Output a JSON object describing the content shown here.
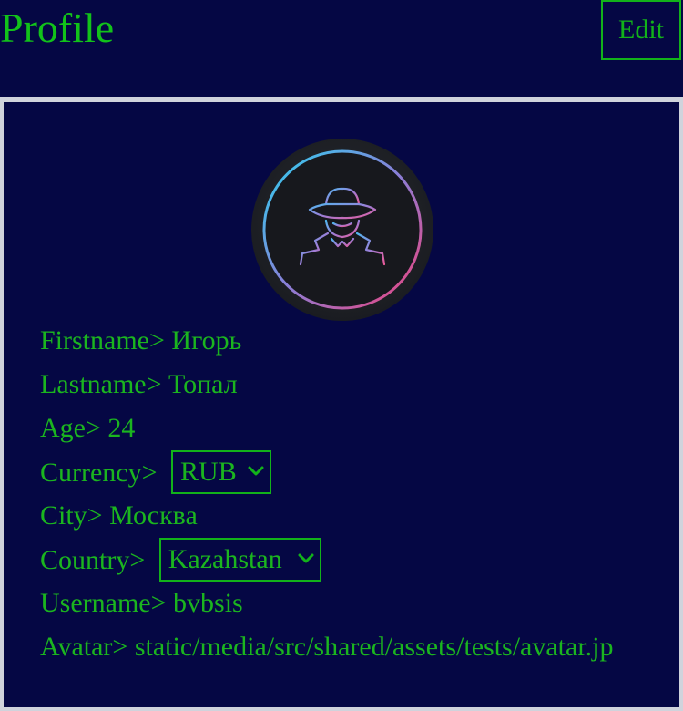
{
  "header": {
    "title": "Profile",
    "edit_label": "Edit"
  },
  "profile": {
    "firstname_label": "Firstname>",
    "firstname": "Игорь",
    "lastname_label": "Lastname>",
    "lastname": "Топал",
    "age_label": "Age>",
    "age": "24",
    "currency_label": "Currency>",
    "currency": "RUB",
    "city_label": "City>",
    "city": "Москва",
    "country_label": "Country>",
    "country": "Kazahstan",
    "username_label": "Username>",
    "username": "bvbsis",
    "avatar_label": "Avatar>",
    "avatar_path": "static/media/src/shared/assets/tests/avatar.jp"
  },
  "avatar_icon": "spy-hat-avatar-icon",
  "colors": {
    "background": "#050744",
    "accent": "#12b21a",
    "divider": "#d0d3dc"
  }
}
